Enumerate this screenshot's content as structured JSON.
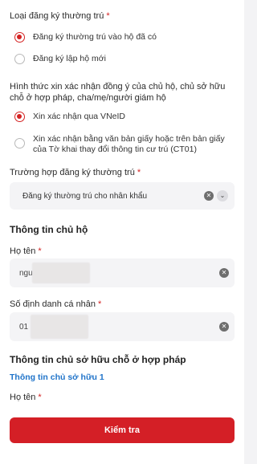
{
  "residence_type": {
    "label": "Loại đăng ký thường trú",
    "required_mark": "*",
    "options": [
      {
        "label": "Đăng ký thường trú vào hộ đã có",
        "selected": true
      },
      {
        "label": "Đăng ký lập hộ mới",
        "selected": false
      }
    ]
  },
  "consent_method": {
    "label": "Hình thức xin xác nhận đồng ý của chủ hộ, chủ sở hữu chỗ ở hợp pháp, cha/mẹ/người giám hộ",
    "options": [
      {
        "label": "Xin xác nhận qua VNeID",
        "selected": true
      },
      {
        "label": "Xin xác nhận bằng văn bản giấy hoặc trên bản giấy của Tờ khai thay đổi thông tin cư trú (CT01)",
        "selected": false
      }
    ]
  },
  "registration_case": {
    "label": "Trường hợp đăng ký thường trú",
    "required_mark": "*",
    "value": "Đăng ký thường trú cho nhân khẩu"
  },
  "household_head": {
    "title": "Thông tin chủ hộ",
    "name_label": "Họ tên",
    "name_value": "ngu",
    "id_label": "Số định danh cá nhân",
    "id_value": "01",
    "required_mark": "*"
  },
  "owner": {
    "title": "Thông tin chủ sở hữu chỗ ở hợp pháp",
    "link": "Thông tin chủ sở hữu 1",
    "name_label": "Họ tên",
    "required_mark": "*"
  },
  "submit_label": "Kiểm tra",
  "colors": {
    "accent": "#d41f26",
    "link": "#1f73c9"
  }
}
